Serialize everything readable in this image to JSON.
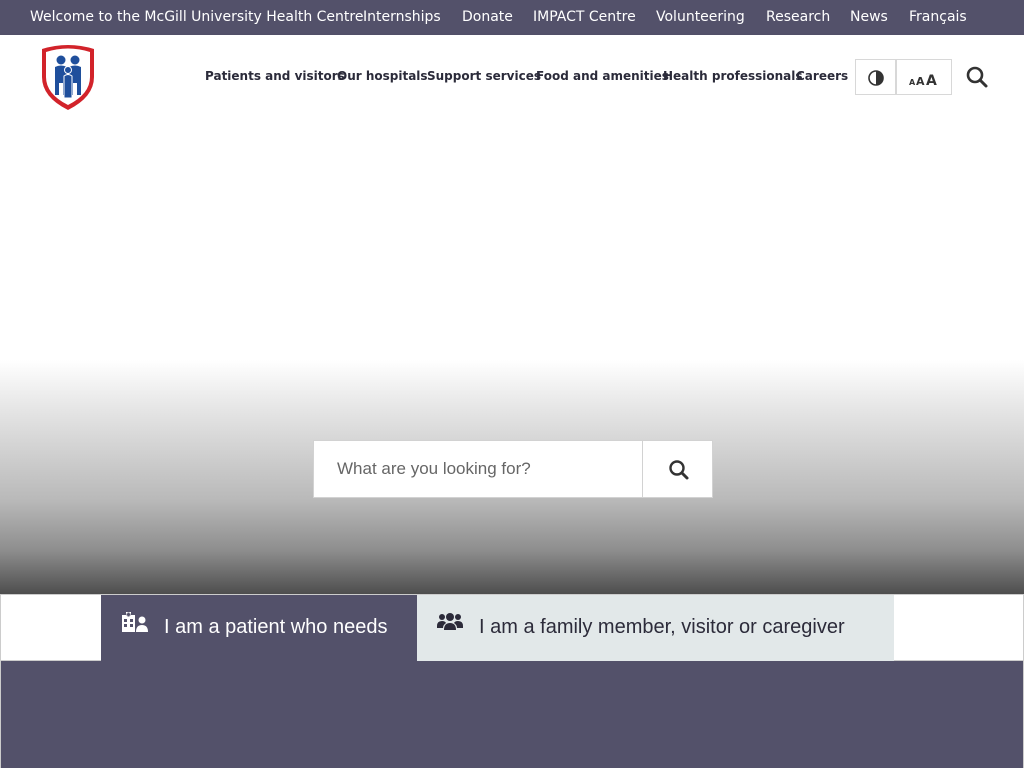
{
  "topbar": {
    "welcome": "Welcome to the McGill University Health Centre",
    "links": [
      "Internships",
      "Donate",
      "IMPACT Centre",
      "Volunteering",
      "Research",
      "News",
      "Français"
    ]
  },
  "nav": {
    "items": [
      "Patients and visitors",
      "Our hospitals",
      "Support services",
      "Food and amenities",
      "Health professionals",
      "Careers"
    ]
  },
  "hero": {
    "search_placeholder": "What are you looking for?"
  },
  "tabs": {
    "patient": "I am a patient who needs",
    "family": "I am a family member, visitor or caregiver"
  },
  "colors": {
    "brand_purple": "#53516a",
    "tab_light": "#e2e8e9",
    "logo_red": "#d2232a",
    "logo_blue": "#1f4f9c"
  }
}
